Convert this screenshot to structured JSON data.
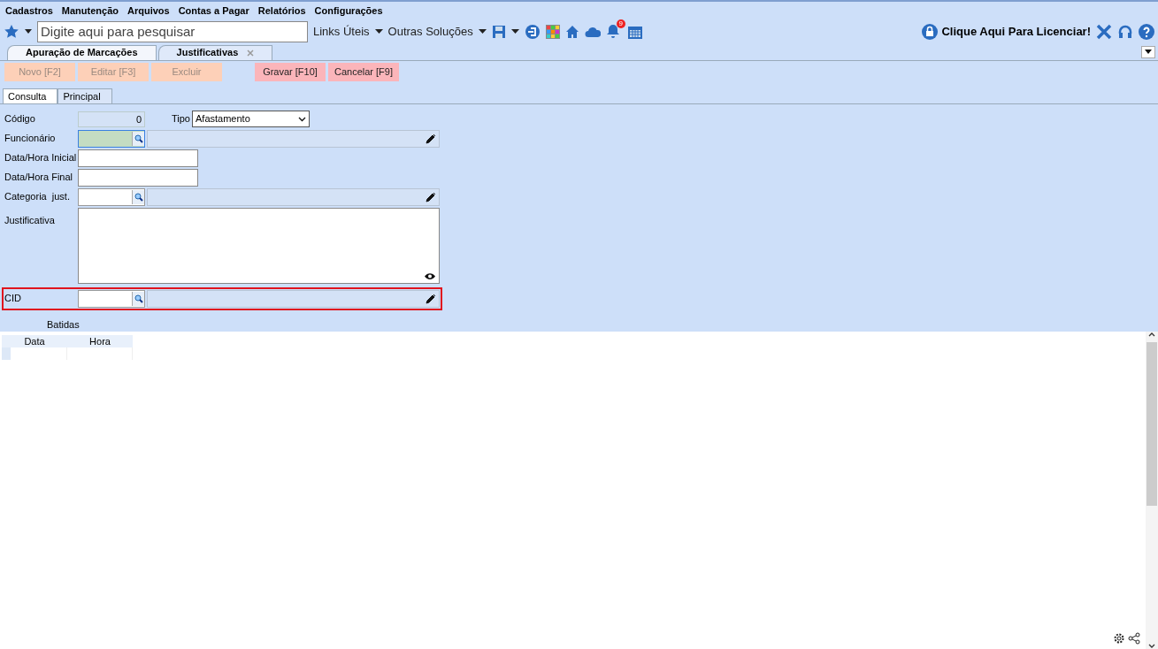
{
  "menu": [
    "Cadastros",
    "Manutenção",
    "Arquivos",
    "Contas a Pagar",
    "Relatórios",
    "Configurações"
  ],
  "toolbar": {
    "search": {
      "placeholder": "Digite aqui para pesquisar"
    },
    "links": [
      "Links Úteis",
      "Outras Soluções"
    ],
    "notification_count": "9",
    "license": "Clique Aqui Para Licenciar!"
  },
  "doc_tabs": [
    {
      "label": "Apuração de Marcações",
      "selected": false,
      "closable": false
    },
    {
      "label": "Justificativas",
      "selected": true,
      "closable": true
    }
  ],
  "actions": [
    {
      "label": "Novo [F2]",
      "disabled": true
    },
    {
      "label": "Editar [F3]",
      "disabled": true
    },
    {
      "label": "Excluir",
      "disabled": true
    },
    {
      "label": "Gravar [F10]",
      "disabled": false
    },
    {
      "label": "Cancelar [F9]",
      "disabled": false
    }
  ],
  "sub_tabs": [
    {
      "label": "Consulta",
      "selected": true
    },
    {
      "label": "Principal",
      "selected": false
    }
  ],
  "form": {
    "codigo": {
      "label": "Código",
      "value": "0"
    },
    "tipo": {
      "label": "Tipo",
      "value": "Afastamento"
    },
    "rows": [
      {
        "kind": "lookup",
        "label": "Funcionário",
        "focused": true,
        "highlighted": false
      },
      {
        "kind": "text",
        "label": "Data/Hora Inicial",
        "focused": false,
        "highlighted": false
      },
      {
        "kind": "text",
        "label": "Data/Hora Final",
        "focused": false,
        "highlighted": false
      },
      {
        "kind": "lookup",
        "label": "Categoria  just.",
        "focused": false,
        "highlighted": false
      },
      {
        "kind": "memo",
        "label": "Justificativa",
        "focused": false,
        "highlighted": false
      },
      {
        "kind": "lookup",
        "label": "CID",
        "focused": false,
        "highlighted": true
      }
    ],
    "batidas_label": "Batidas"
  },
  "grid": {
    "columns": [
      "Data",
      "Hora"
    ]
  }
}
